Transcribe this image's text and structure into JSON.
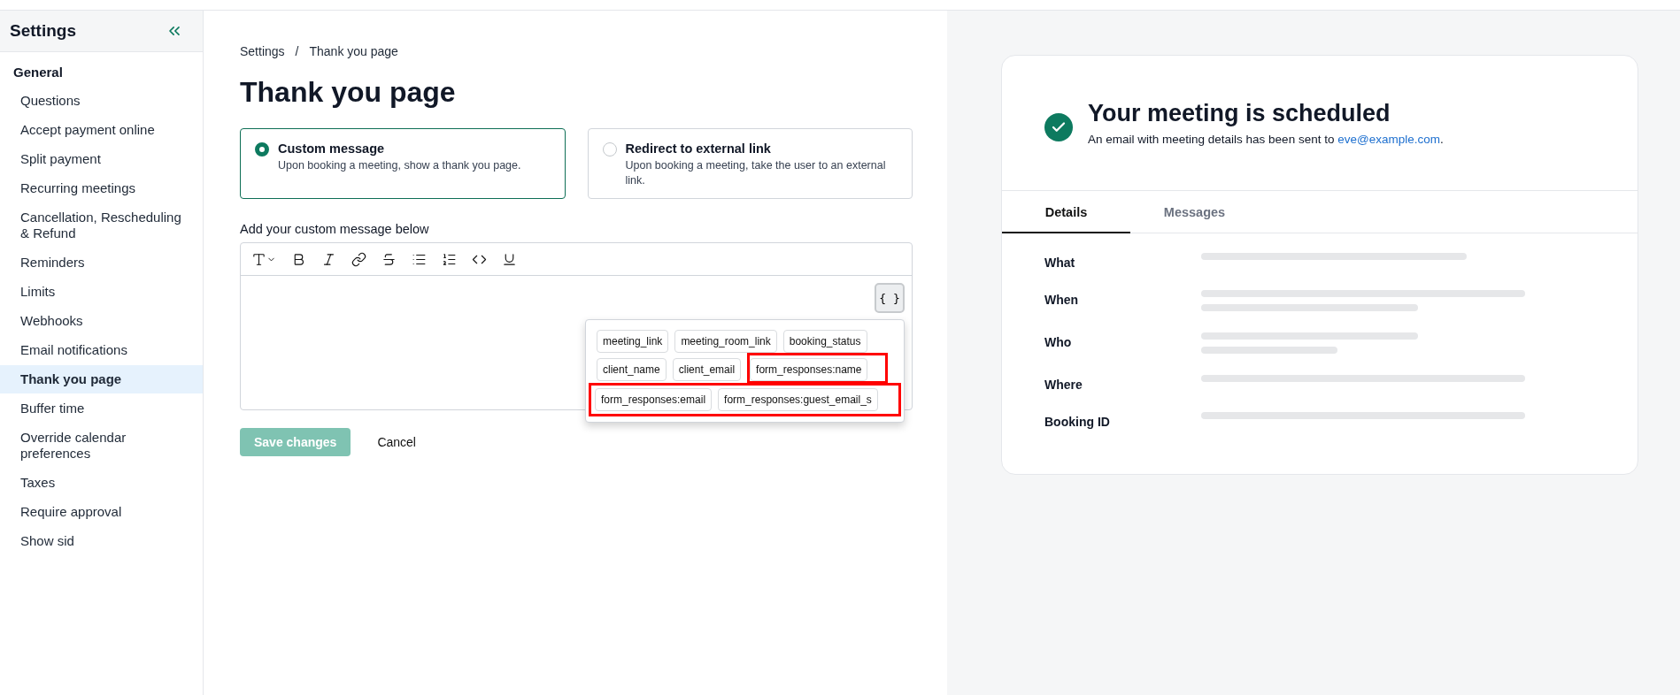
{
  "sidebar": {
    "title": "Settings",
    "section": "General",
    "items": [
      {
        "label": "Questions",
        "selected": false
      },
      {
        "label": "Accept payment online",
        "selected": false
      },
      {
        "label": "Split payment",
        "selected": false
      },
      {
        "label": "Recurring meetings",
        "selected": false
      },
      {
        "label": "Cancellation, Rescheduling & Refund",
        "selected": false
      },
      {
        "label": "Reminders",
        "selected": false
      },
      {
        "label": "Limits",
        "selected": false
      },
      {
        "label": "Webhooks",
        "selected": false
      },
      {
        "label": "Email notifications",
        "selected": false
      },
      {
        "label": "Thank you page",
        "selected": true
      },
      {
        "label": "Buffer time",
        "selected": false
      },
      {
        "label": "Override calendar preferences",
        "selected": false
      },
      {
        "label": "Taxes",
        "selected": false
      },
      {
        "label": "Require approval",
        "selected": false
      },
      {
        "label": "Show sid",
        "selected": false
      }
    ]
  },
  "breadcrumb": [
    "Settings",
    "Thank you page"
  ],
  "breadcrumb_separator": "/",
  "title": "Thank you page",
  "options": [
    {
      "title": "Custom message",
      "description": "Upon booking a meeting, show a thank you page.",
      "selected": true
    },
    {
      "title": "Redirect to external link",
      "description": "Upon booking a meeting, take the user to an external link.",
      "selected": false
    }
  ],
  "editor": {
    "label": "Add your custom message below",
    "variables_button": "{ }",
    "variable_rows": [
      {
        "highlighted": false,
        "chips": [
          {
            "label": "meeting_link",
            "highlighted": false
          },
          {
            "label": "meeting_room_link",
            "highlighted": false
          },
          {
            "label": "booking_status",
            "highlighted": false
          }
        ]
      },
      {
        "highlighted": false,
        "chips": [
          {
            "label": "client_name",
            "highlighted": false
          },
          {
            "label": "client_email",
            "highlighted": false
          },
          {
            "label": "form_responses:name",
            "highlighted": true
          }
        ]
      },
      {
        "highlighted": true,
        "chips": [
          {
            "label": "form_responses:email",
            "highlighted": false
          },
          {
            "label": "form_responses:guest_email_s",
            "highlighted": false
          }
        ]
      }
    ]
  },
  "actions": {
    "save": {
      "label": "Save changes",
      "disabled": true
    },
    "cancel": "Cancel"
  },
  "preview": {
    "title": "Your meeting is scheduled",
    "message": "An email with meeting details has been sent to",
    "email": "eve@example.com",
    "message_end": ".",
    "tabs": [
      {
        "label": "Details",
        "selected": true
      },
      {
        "label": "Messages",
        "selected": false
      }
    ],
    "fields": [
      "What",
      "When",
      "Who",
      "Where",
      "Booking ID"
    ]
  }
}
